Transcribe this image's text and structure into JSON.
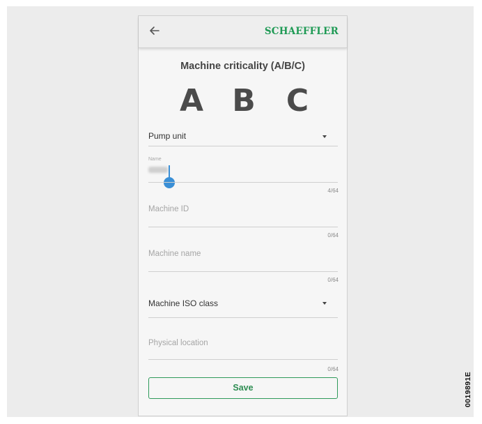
{
  "appbar": {
    "back_icon": "arrow-left-icon",
    "brand": "SCHAEFFLER",
    "brand_color": "#1f9a55"
  },
  "criticality": {
    "title": "Machine criticality (A/B/C)",
    "classes": [
      "A",
      "B",
      "C"
    ]
  },
  "pump_unit": {
    "label": "Pump unit",
    "icon": "dropdown-arrow-icon"
  },
  "name_field": {
    "label": "Name",
    "value": "",
    "counter": "4/64"
  },
  "machine_id": {
    "placeholder": "Machine ID",
    "counter": "0/64"
  },
  "machine_name": {
    "placeholder": "Machine name",
    "counter": "0/64"
  },
  "iso_class": {
    "label": "Machine ISO class",
    "icon": "dropdown-arrow-icon"
  },
  "location": {
    "placeholder": "Physical location",
    "counter": "0/64"
  },
  "save": {
    "label": "Save",
    "color": "#2e9a5a"
  },
  "figure_code": "0019891E"
}
